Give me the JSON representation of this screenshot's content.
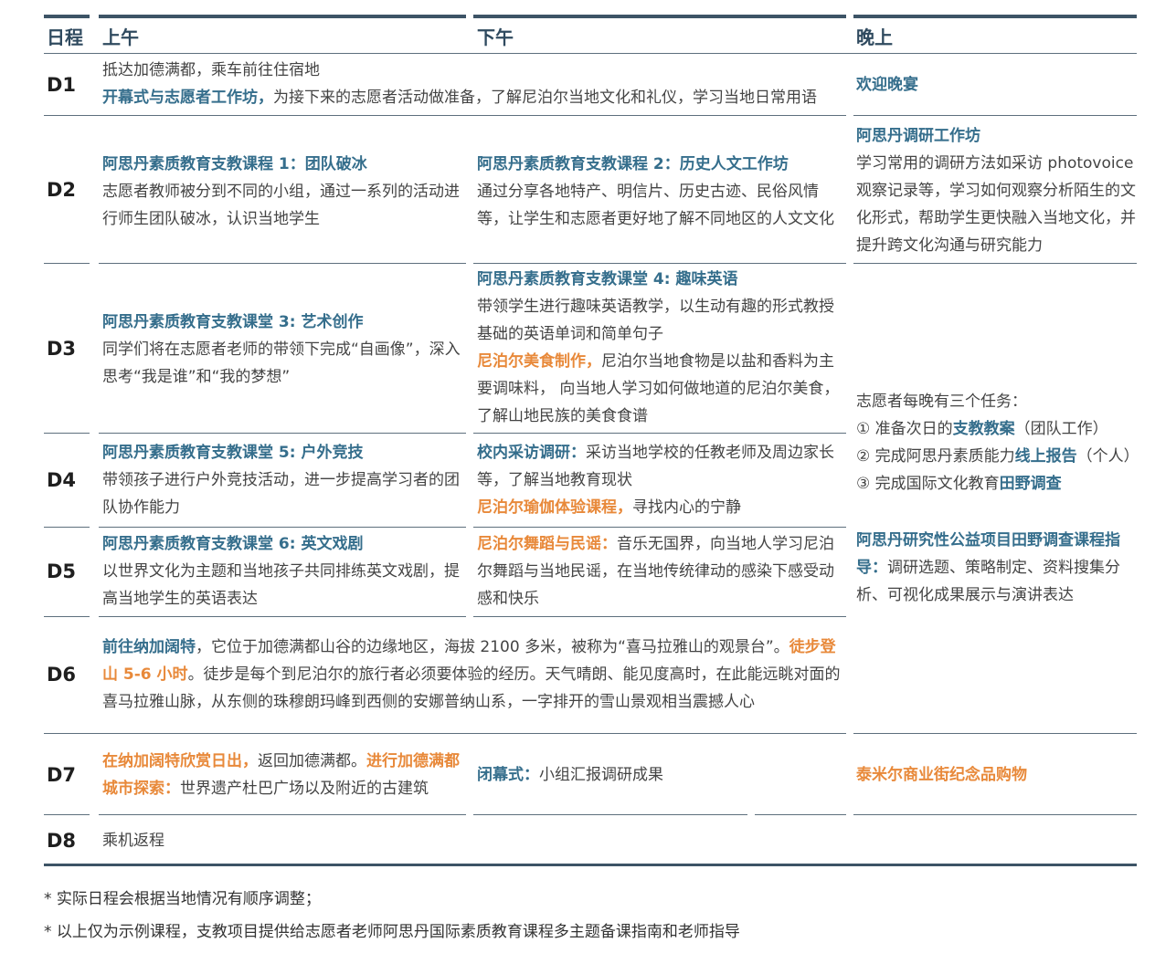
{
  "header": {
    "day": "日程",
    "morning": "上午",
    "afternoon": "下午",
    "evening": "晚上"
  },
  "rows": {
    "d1": {
      "label": "D1",
      "line1": "抵达加德满都，乘车前往住宿地",
      "line2_title": "开幕式与志愿者工作坊，",
      "line2_text": "为接下来的志愿者活动做准备，了解尼泊尔当地文化和礼仪，学习当地日常用语",
      "evening": "欢迎晚宴"
    },
    "d2": {
      "label": "D2",
      "am_title": "阿思丹素质教育支教课程 1：团队破冰",
      "am_text": "志愿者教师被分到不同的小组，通过一系列的活动进行师生团队破冰，认识当地学生",
      "pm_title": "阿思丹素质教育支教课程 2：历史人文工作坊",
      "pm_text": "通过分享各地特产、明信片、历史古迹、民俗风情等，让学生和志愿者更好地了解不同地区的人文文化",
      "ev_title": "阿思丹调研工作坊",
      "ev_text": "学习常用的调研方法如采访 photovoice 观察记录等，学习如何观察分析陌生的文化形式，帮助学生更快融入当地文化，并提升跨文化沟通与研究能力"
    },
    "d3": {
      "label": "D3",
      "am_title": "阿思丹素质教育支教课堂 3: 艺术创作",
      "am_text": "同学们将在志愿者老师的带领下完成“自画像”，深入思考“我是谁”和“我的梦想”",
      "pm_title": "阿思丹素质教育支教课堂 4: 趣味英语",
      "pm_text": "带领学生进行趣味英语教学，以生动有趣的形式教授基础的英语单词和简单句子",
      "pm_title2": "尼泊尔美食制作，",
      "pm_text2": "尼泊尔当地食物是以盐和香料为主要调味料， 向当地人学习如何做地道的尼泊尔美食，了解山地民族的美食食谱"
    },
    "tasks": {
      "intro": "志愿者每晚有三个任务：",
      "t1_pre": "① 准备次日的",
      "t1_bold": "支教教案",
      "t1_post": "（团队工作）",
      "t2_pre": "② 完成阿思丹素质能力",
      "t2_bold": "线上报告",
      "t2_post": "（个人）",
      "t3_pre": "③ 完成国际文化教育",
      "t3_bold": "田野调查"
    },
    "d4": {
      "label": "D4",
      "am_title": "阿思丹素质教育支教课堂 5: 户外竞技",
      "am_text": "带领孩子进行户外竞技活动，进一步提高学习者的团队协作能力",
      "pm_title": "校内采访调研：",
      "pm_text": "采访当地学校的任教老师及周边家长等，了解当地教育现状",
      "pm_title2": "尼泊尔瑜伽体验课程，",
      "pm_text2": "寻找内心的宁静"
    },
    "d5": {
      "label": "D5",
      "am_title": "阿思丹素质教育支教课堂 6: 英文戏剧",
      "am_text": "以世界文化为主题和当地孩子共同排练英文戏剧，提高当地学生的英语表达",
      "pm_title": "尼泊尔舞蹈与民谣：",
      "pm_text": "音乐无国界，向当地人学习尼泊尔舞蹈与当地民谣，在当地传统律动的感染下感受动感和快乐",
      "ev_title": "阿思丹研究性公益项目田野调查课程指导：",
      "ev_text": "调研选题、策略制定、资料搜集分析、可视化成果展示与演讲表达"
    },
    "d6": {
      "label": "D6",
      "title1": "前往纳加阔特",
      "text1": "，它位于加德满都山谷的边缘地区，海拔 2100 多米，被称为“喜马拉雅山的观景台”。",
      "title2": "徒步登山 5-6 小时",
      "text2": "。徒步是每个到尼泊尔的旅行者必须要体验的经历。天气晴朗、能见度高时，在此能远眺对面的喜马拉雅山脉，从东侧的珠穆朗玛峰到西侧的安娜普纳山系，一字排开的雪山景观相当震撼人心"
    },
    "d7": {
      "label": "D7",
      "am_title1": "在纳加阔特欣赏日出，",
      "am_text1": "返回加德满都。",
      "am_title2": "进行加德满都城市探索：",
      "am_text2": "世界遗产杜巴广场以及附近的古建筑",
      "pm_title": "闭幕式：",
      "pm_text": "小组汇报调研成果",
      "evening": "泰米尔商业街纪念品购物"
    },
    "d8": {
      "label": "D8",
      "text": "乘机返程"
    }
  },
  "notes": [
    "* 实际日程会根据当地情况有顺序调整；",
    "* 以上仅为示例课程，支教项目提供给志愿者老师阿思丹国际素质教育课程多主题备课指南和老师指导"
  ],
  "colors": {
    "rule": "#3d5466",
    "title_blue": "#356e8c",
    "title_orange": "#e8893a",
    "header": "#2f4a5f"
  }
}
